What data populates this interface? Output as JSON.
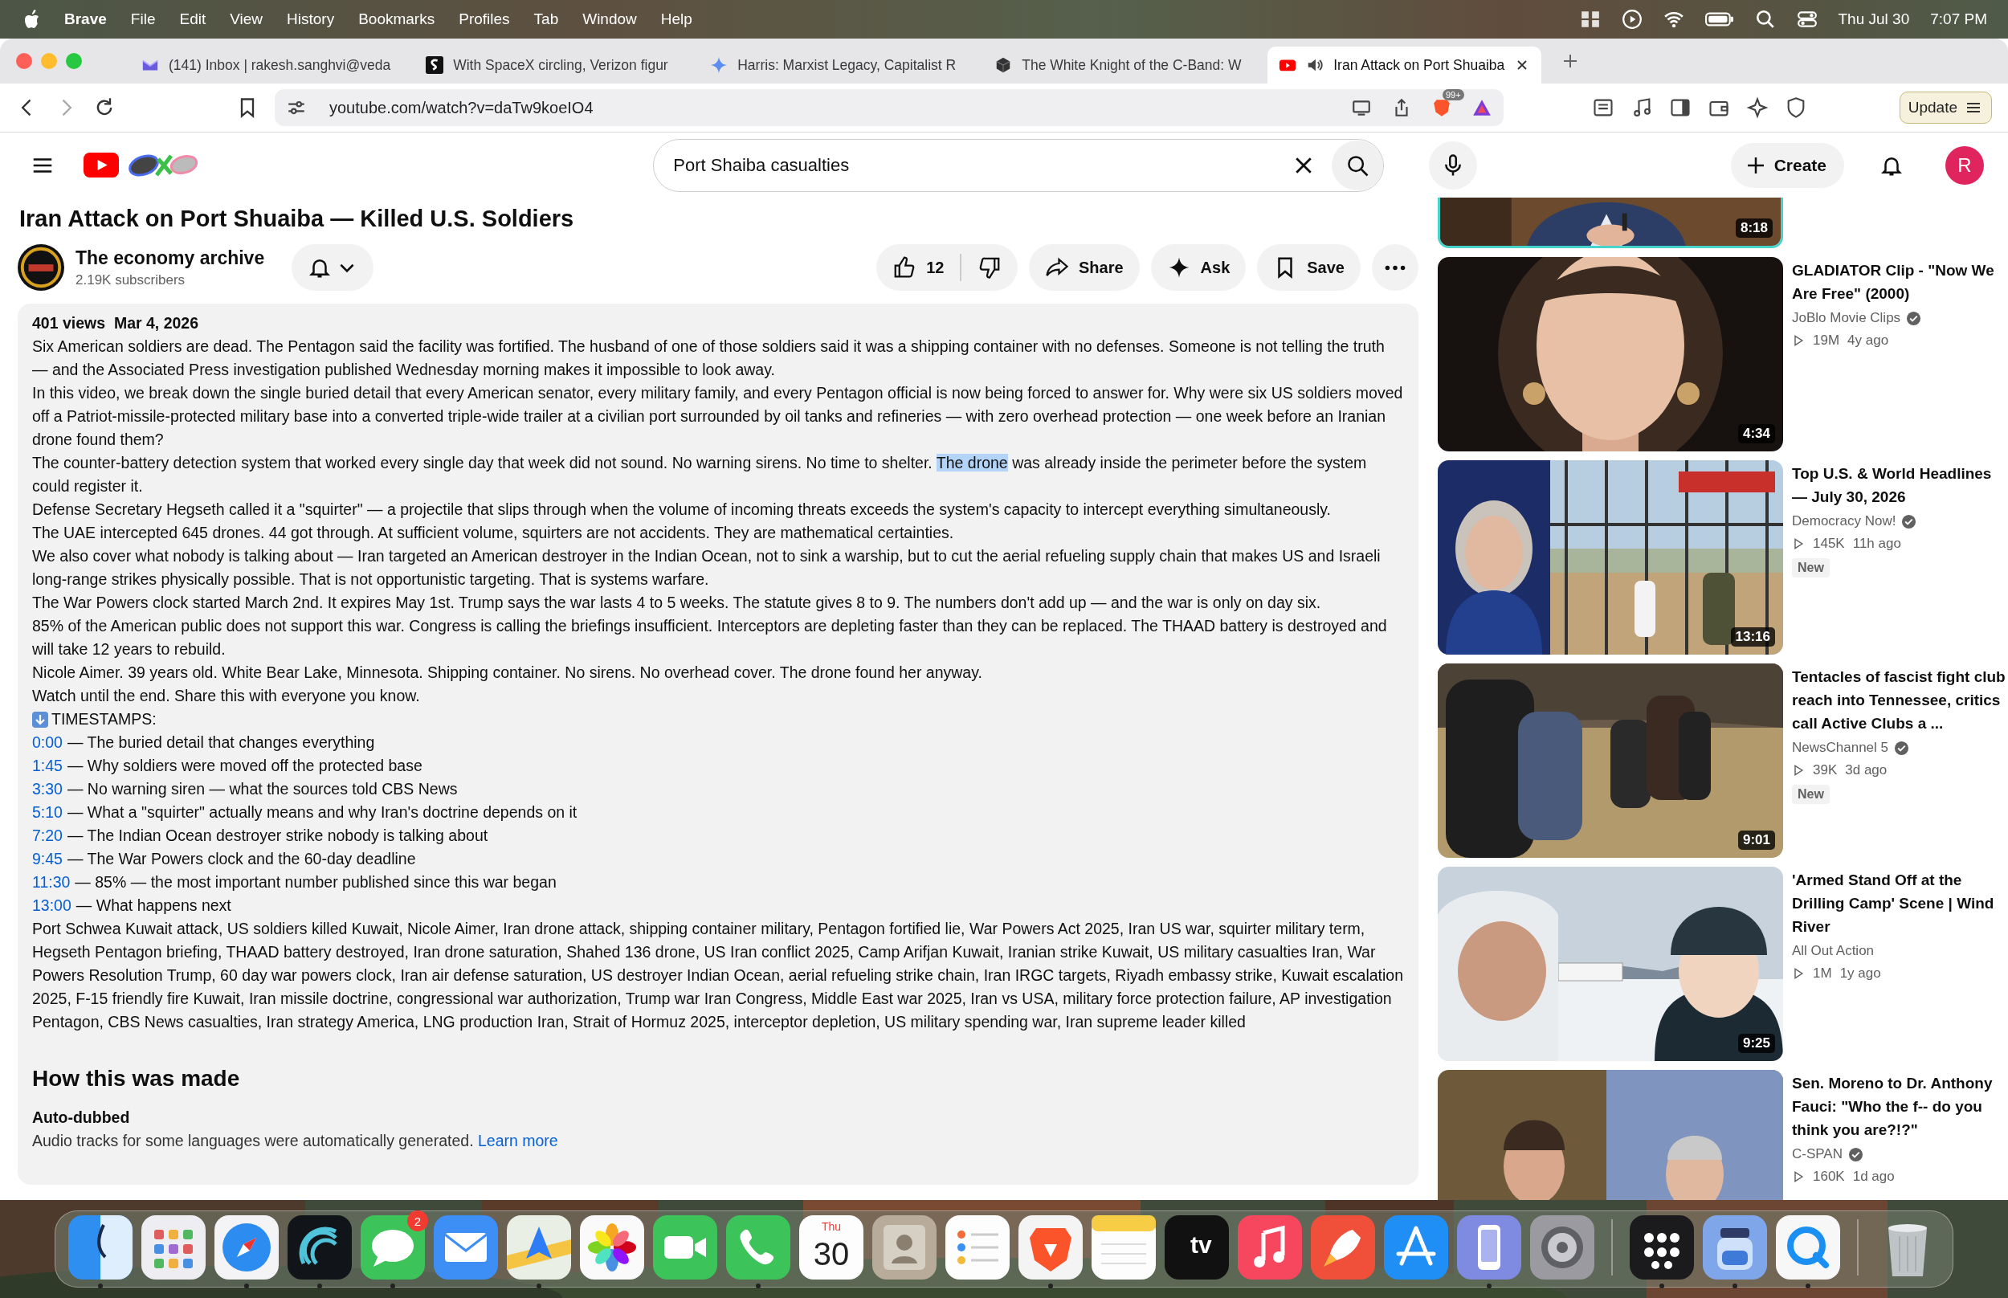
{
  "menu_bar": {
    "app": "Brave",
    "menus": [
      "File",
      "Edit",
      "View",
      "History",
      "Bookmarks",
      "Profiles",
      "Tab",
      "Window",
      "Help"
    ],
    "date": "Thu Jul 30",
    "time": "7:07 PM"
  },
  "tabs": [
    {
      "title": "(141) Inbox | rakesh.sanghvi@veda",
      "kind": "mail",
      "selected": false,
      "audio": false
    },
    {
      "title": "With SpaceX circling, Verizon figur",
      "kind": "square-logo",
      "selected": false,
      "audio": false
    },
    {
      "title": "Harris: Marxist Legacy, Capitalist R",
      "kind": "spark",
      "selected": false,
      "audio": false
    },
    {
      "title": "The White Knight of the C-Band: W",
      "kind": "cube",
      "selected": false,
      "audio": false
    },
    {
      "title": "Iran Attack on Port Shuaiba",
      "kind": "video",
      "selected": true,
      "audio": true
    }
  ],
  "address_bar": {
    "url": "youtube.com/watch?v=daTw9koeIO4",
    "shield_badge": "99+",
    "update_label": "Update"
  },
  "header": {
    "search": {
      "value": "Port Shaiba casualties"
    },
    "create_label": "Create",
    "avatar_letter": "R"
  },
  "video": {
    "title": "Iran Attack on Port Shuaiba — Killed U.S. Soldiers",
    "channel": "The economy archive",
    "subscribers": "2.19K subscribers",
    "likes": "12",
    "actions": [
      {
        "kind": "share",
        "label": "Share"
      },
      {
        "kind": "ask",
        "label": "Ask"
      },
      {
        "kind": "save",
        "label": "Save"
      }
    ]
  },
  "description": {
    "stats": "401 views  Mar 4, 2026",
    "paragraphs": [
      [
        {
          "text": "Six American soldiers are dead. The Pentagon said the facility was fortified. The husband of one of those soldiers said it was a shipping container with no defenses. Someone is not telling the truth — and the Associated Press investigation published Wednesday morning makes it impossible to look away.",
          "selected": false
        }
      ],
      [
        {
          "text": "In this video, we break down the single buried detail that every American senator, every military family, and every Pentagon official is now being forced to answer for. Why were six US soldiers moved off a Patriot-missile-protected military base into a converted triple-wide trailer at a civilian port surrounded by oil tanks and refineries — with zero overhead protection — one week before an Iranian drone found them?",
          "selected": false
        }
      ],
      [
        {
          "text": "The counter-battery detection system that worked every single day that week did not sound. No warning sirens. No time to shelter. ",
          "selected": false
        },
        {
          "text": "The drone",
          "selected": true
        },
        {
          "text": " was already inside the perimeter before the system could register it.",
          "selected": false
        }
      ],
      [
        {
          "text": "Defense Secretary Hegseth called it a \"squirter\" — a projectile that slips through when the volume of incoming threats exceeds the system's capacity to intercept everything simultaneously.",
          "selected": false
        }
      ],
      [
        {
          "text": "The UAE intercepted 645 drones. 44 got through. At sufficient volume, squirters are not accidents. They are mathematical certainties.",
          "selected": false
        }
      ],
      [
        {
          "text": "We also cover what nobody is talking about — Iran targeted an American destroyer in the Indian Ocean, not to sink a warship, but to cut the aerial refueling supply chain that makes US and Israeli long-range strikes physically possible. That is not opportunistic targeting. That is systems warfare.",
          "selected": false
        }
      ],
      [
        {
          "text": "The War Powers clock started March 2nd. It expires May 1st. Trump says the war lasts 4 to 5 weeks. The statute gives 8 to 9. The numbers don't add up — and the war is only on day six.",
          "selected": false
        }
      ],
      [
        {
          "text": "85% of the American public does not support this war. Congress is calling the briefings insufficient. Interceptors are depleting faster than they can be replaced. The THAAD battery is destroyed and will take 12 years to rebuild.",
          "selected": false
        }
      ],
      [
        {
          "text": "Nicole Aimer. 39 years old. White Bear Lake, Minnesota. Shipping container. No sirens. No overhead cover. The drone found her anyway.",
          "selected": false
        }
      ],
      [
        {
          "text": "Watch until the end. Share this with everyone you know.",
          "selected": false
        }
      ]
    ],
    "timestamps_label": "TIMESTAMPS:",
    "timestamps": [
      {
        "time": "0:00",
        "text": "— The buried detail that changes everything"
      },
      {
        "time": "1:45",
        "text": "— Why soldiers were moved off the protected base"
      },
      {
        "time": "3:30",
        "text": "— No warning siren — what the sources told CBS News"
      },
      {
        "time": "5:10",
        "text": "— What a \"squirter\" actually means and why Iran's doctrine depends on it"
      },
      {
        "time": "7:20",
        "text": "— The Indian Ocean destroyer strike nobody is talking about"
      },
      {
        "time": "9:45",
        "text": "— The War Powers clock and the 60-day deadline"
      },
      {
        "time": "11:30",
        "text": "— 85% — the most important number published since this war began"
      },
      {
        "time": "13:00",
        "text": "— What happens next"
      }
    ],
    "tags": "Port Schwea Kuwait attack, US soldiers killed Kuwait, Nicole Aimer, Iran drone attack, shipping container military, Pentagon fortified lie, War Powers Act 2025, Iran US war, squirter military term, Hegseth Pentagon briefing, THAAD battery destroyed, Iran drone saturation, Shahed 136 drone, US Iran conflict 2025, Camp Arifjan Kuwait, Iranian strike Kuwait, US military casualties Iran, War Powers Resolution Trump, 60 day war powers clock, Iran air defense saturation, US destroyer Indian Ocean, aerial refueling strike chain, Iran IRGC targets, Riyadh embassy strike, Kuwait escalation 2025, F-15 friendly fire Kuwait, Iran missile doctrine, congressional war authorization, Trump war Iran Congress, Middle East war 2025, Iran vs USA, military force protection failure, AP investigation Pentagon, CBS News casualties, Iran strategy America, LNG production Iran, Strait of Hormuz 2025, interceptor depletion, US military spending war, Iran supreme leader killed",
    "made_heading": "How this was made",
    "made_title": "Auto-dubbed",
    "made_text": "Audio tracks for some languages were automatically generated.",
    "learn_more": "Learn more"
  },
  "sidebar": {
    "partial_video": {
      "duration": "8:18"
    },
    "videos": [
      {
        "title": "GLADIATOR Clip - \"Now We Are Free\" (2000)",
        "channel": "JoBlo Movie Clips",
        "verified": true,
        "views": "19M",
        "age": "4y ago",
        "new": false,
        "duration": "4:34"
      },
      {
        "title": "Top U.S. & World Headlines — July 30, 2026",
        "channel": "Democracy Now!",
        "verified": true,
        "views": "145K",
        "age": "11h ago",
        "new": true,
        "new_label": "New",
        "duration": "13:16"
      },
      {
        "title": "Tentacles of fascist fight club reach into Tennessee, critics call Active Clubs a ...",
        "channel": "NewsChannel 5",
        "verified": true,
        "views": "39K",
        "age": "3d ago",
        "new": true,
        "new_label": "New",
        "duration": "9:01"
      },
      {
        "title": "'Armed Stand Off at the Drilling Camp' Scene | Wind River",
        "channel": "All Out Action",
        "verified": false,
        "views": "1M",
        "age": "1y ago",
        "new": false,
        "duration": "9:25"
      },
      {
        "title": "Sen. Moreno to Dr. Anthony Fauci: \"Who the f-- do you think you are?!?\"",
        "channel": "C-SPAN",
        "verified": true,
        "views": "160K",
        "age": "1d ago",
        "new": false
      }
    ]
  },
  "dock": {
    "apps": [
      {
        "kind": "finder",
        "running": true
      },
      {
        "kind": "launchpad",
        "running": false
      },
      {
        "kind": "safari",
        "running": true
      },
      {
        "kind": "wave",
        "running": true
      },
      {
        "kind": "messages",
        "running": true,
        "badge": "2"
      },
      {
        "kind": "mail",
        "running": false
      },
      {
        "kind": "maps",
        "running": true
      },
      {
        "kind": "photos",
        "running": false
      },
      {
        "kind": "facetime",
        "running": false
      },
      {
        "kind": "phone",
        "running": true
      },
      {
        "kind": "calendar",
        "running": false,
        "day_name": "Thu",
        "day": "30"
      },
      {
        "kind": "contacts",
        "running": false
      },
      {
        "kind": "reminders",
        "running": false
      },
      {
        "kind": "brave",
        "running": true
      },
      {
        "kind": "notes",
        "running": false
      },
      {
        "kind": "tv",
        "running": false,
        "label": "tv"
      },
      {
        "kind": "music",
        "running": false
      },
      {
        "kind": "rocket",
        "running": false
      },
      {
        "kind": "appstore",
        "running": false
      },
      {
        "kind": "mirroring",
        "running": true
      },
      {
        "kind": "settings",
        "running": false
      }
    ],
    "recent": [
      {
        "kind": "grid",
        "running": true
      },
      {
        "kind": "jar",
        "running": true
      },
      {
        "kind": "qapp",
        "running": true
      }
    ],
    "trash": {
      "kind": "trash",
      "running": false
    }
  }
}
